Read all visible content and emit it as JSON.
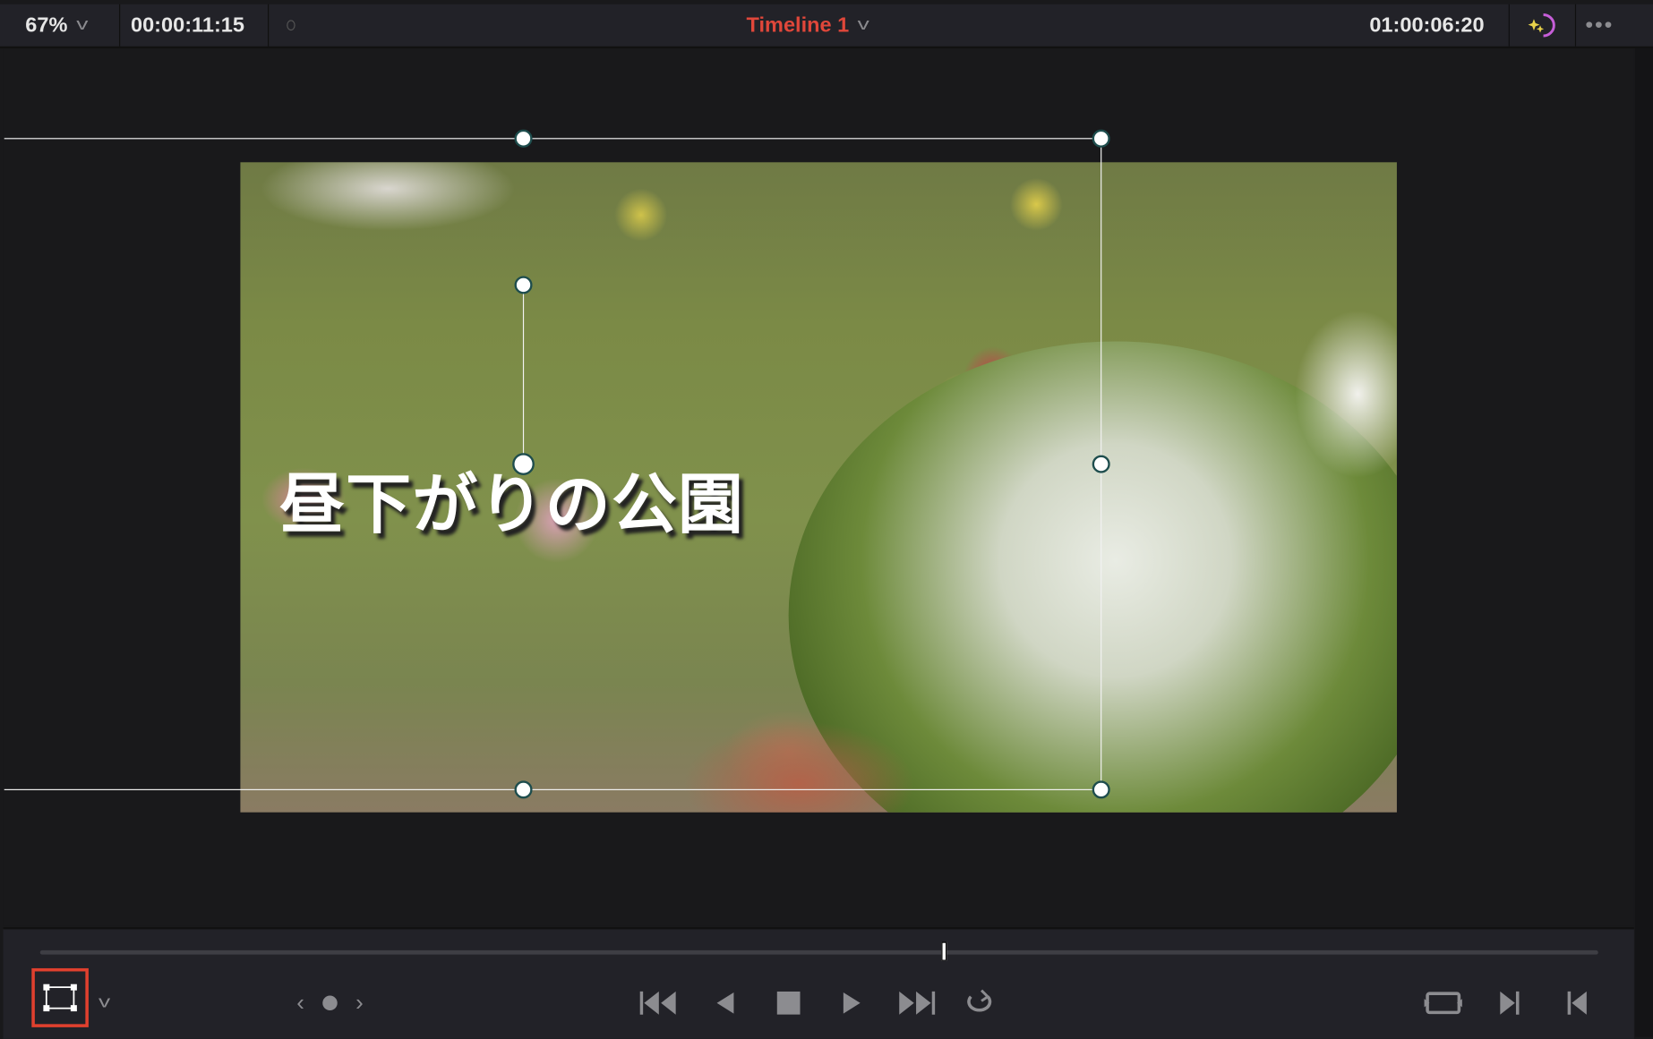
{
  "topbar": {
    "zoom": "67%",
    "timecode_left": "00:00:11:15",
    "timeline_name": "Timeline 1",
    "timecode_right": "01:00:06:20",
    "accent": "#e0473a"
  },
  "viewer": {
    "title_overlay": "昼下がりの公園"
  },
  "transport": {
    "playhead_position_percent": 58
  }
}
